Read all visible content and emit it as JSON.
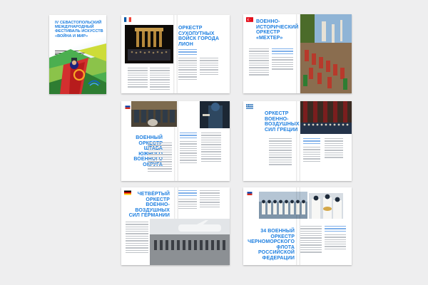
{
  "brochure": {
    "cover": {
      "title": "IV СЕВАСТОПОЛЬСКИЙ МЕЖДУНАРОДНЫЙ ФЕСТИВАЛЬ ИСКУССТВ «ВОЙНА И МИР»"
    },
    "spreads": [
      {
        "id": "france",
        "title": "ОРКЕСТР СУХОПУТНЫХ ВОЙСК ГОРОДА ЛИОН"
      },
      {
        "id": "turkey",
        "title": "ВОЕННО-ИСТОРИЧЕСКИЙ ОРКЕСТР «МЕХТЕР»"
      },
      {
        "id": "russia-south",
        "title": "ВОЕННЫЙ ОРКЕСТР ШТАБА ЮЖНОГО ВОЕННОГО ОКРУГА"
      },
      {
        "id": "greece",
        "title": "ОРКЕСТР ВОЕННО-ВОЗДУШНЫХ СИЛ ГРЕЦИИ"
      },
      {
        "id": "germany",
        "title": "ЧЕТВЁРТЫЙ ОРКЕСТР ВОЕННО-ВОЗДУШНЫХ СИЛ ГЕРМАНИИ"
      },
      {
        "id": "russia-navy",
        "title": "34 ВОЕННЫЙ ОРКЕСТР ЧЕРНОМОРСКОГО ФЛОТА РОССИЙСКОЙ ФЕДЕРАЦИИ"
      }
    ]
  },
  "colors": {
    "accent": "#1e7fe0",
    "background": "#eeeeef"
  }
}
